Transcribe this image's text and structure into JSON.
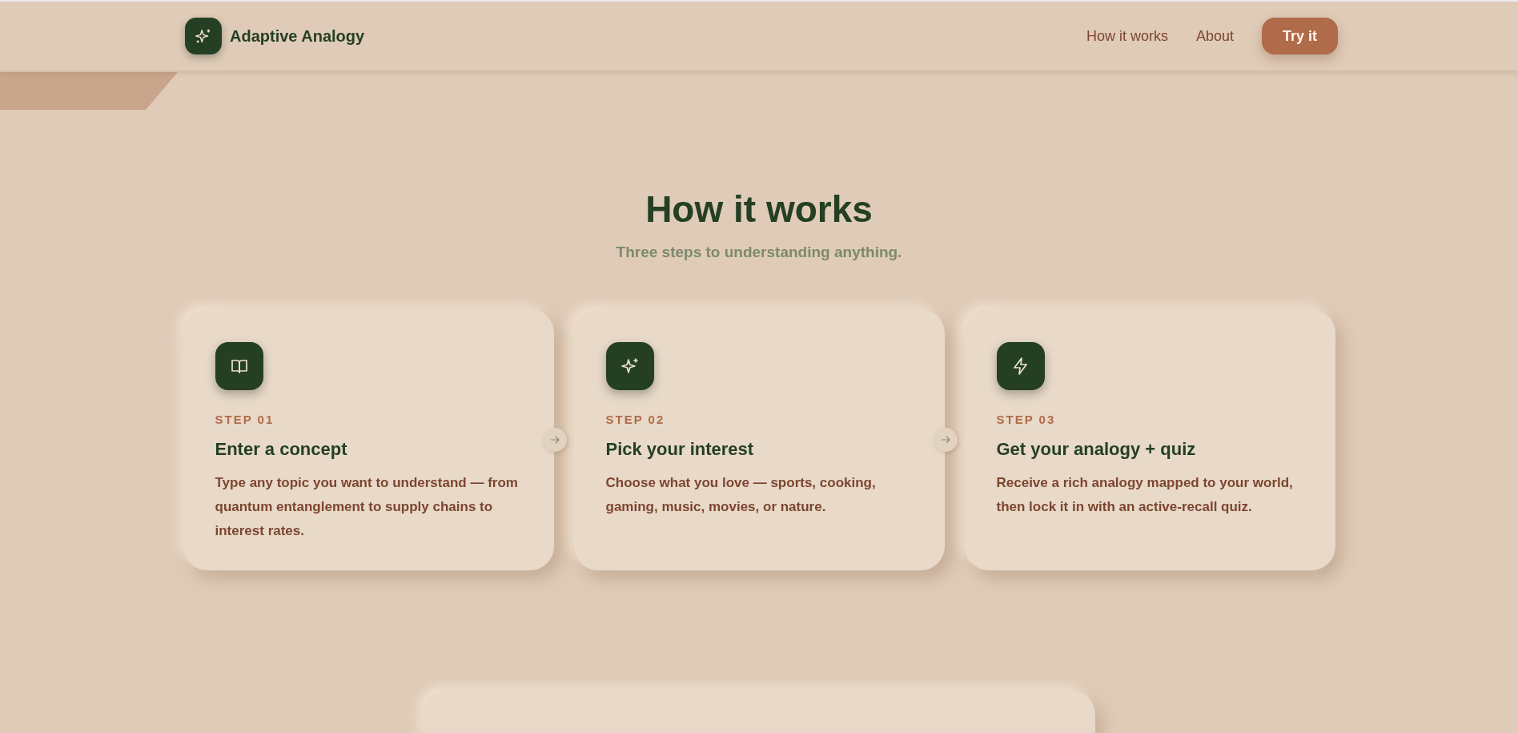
{
  "header": {
    "brand": "Adaptive Analogy",
    "nav": [
      {
        "label": "How it works"
      },
      {
        "label": "About"
      }
    ],
    "cta": "Try it"
  },
  "section": {
    "title": "How it works",
    "subtitle": "Three steps to understanding anything.",
    "steps": [
      {
        "kind": "book",
        "step": "STEP 01",
        "title": "Enter a concept",
        "description": "Type any topic you want to understand — from quantum entanglement to supply chains to interest rates."
      },
      {
        "kind": "sparkle",
        "step": "STEP 02",
        "title": "Pick your interest",
        "description": "Choose what you love — sports, cooking, gaming, music, movies, or nature."
      },
      {
        "kind": "bolt",
        "step": "STEP 03",
        "title": "Get your analogy + quiz",
        "description": "Receive a rich analogy mapped to your world, then lock it in with an active-recall quiz."
      }
    ]
  }
}
